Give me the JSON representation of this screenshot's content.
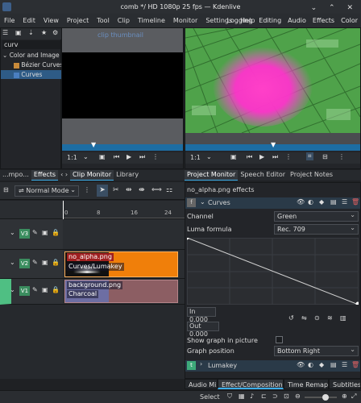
{
  "window": {
    "title": "comb */ HD 1080p 25 fps — Kdenlive",
    "controls": "⌄ ⌃ ✕"
  },
  "menu": [
    "File",
    "Edit",
    "View",
    "Project",
    "Tool",
    "Clip",
    "Timeline",
    "Monitor",
    "Settings",
    "Help"
  ],
  "layouts": [
    "Logging",
    "Editing",
    "Audio",
    "Effects",
    "Color"
  ],
  "effects_panel": {
    "search_value": "curv",
    "tree": [
      {
        "label": "Color and Image corr",
        "indent": 0,
        "expanded": true
      },
      {
        "label": "Bézier Curves",
        "indent": 1
      },
      {
        "label": "Curves",
        "indent": 1,
        "selected": true
      }
    ],
    "tabs": [
      "...mpo...",
      "Effects",
      "Clip Monitor",
      "Library"
    ]
  },
  "clip_monitor": {
    "overlay_text": "clip thumbnail",
    "zoom": "1:1",
    "tabs": [
      "Clip Monitor",
      "Library"
    ]
  },
  "project_monitor": {
    "zoom": "1:1",
    "tabs": [
      "Project Monitor",
      "Speech Editor",
      "Project Notes"
    ]
  },
  "timeline": {
    "edit_mode": "Normal Mode",
    "ruler": [
      "0",
      "8",
      "16",
      "24"
    ],
    "tracks": [
      {
        "id": "V3",
        "clip": null
      },
      {
        "id": "V2",
        "clip": {
          "name": "no_alpha.png",
          "effects": "Curves/Lumakey"
        }
      },
      {
        "id": "V1",
        "clip": {
          "name": "background.png",
          "effects": "Charcoal"
        }
      }
    ]
  },
  "effect_stack": {
    "header": "no_alpha.png effects",
    "effect_name": "Curves",
    "channel_label": "Channel",
    "channel_value": "Green",
    "luma_label": "Luma formula",
    "luma_value": "Rec. 709",
    "in_label": "In",
    "in_value": "0.000",
    "out_label": "Out",
    "out_value": "0.000",
    "show_graph_label": "Show graph in picture",
    "graph_pos_label": "Graph position",
    "graph_pos_value": "Bottom Right",
    "second_effect": "Lumakey"
  },
  "bottom_tabs": [
    "Audio Mixer",
    "Effect/Composition S...",
    "Time Remap...",
    "Subtitles"
  ],
  "status": {
    "select_label": "Select"
  },
  "colors": {
    "accent": "#3daee9",
    "v2_clip": "#f07f0a",
    "v1_clip": "#8c5e63",
    "track_tag": "#3b8d5f"
  }
}
